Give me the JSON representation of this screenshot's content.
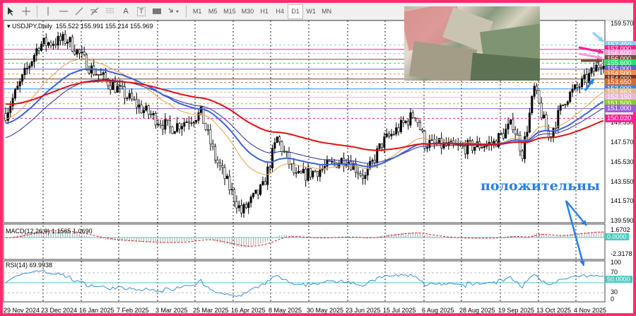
{
  "toolbar": {
    "tools": [
      "cursor",
      "crosshair",
      "vertical-line",
      "horizontal-line",
      "trendline",
      "fibonacci",
      "fibo-channel",
      "text",
      "label",
      "rectangle",
      "arrows"
    ],
    "text_tool": "A",
    "label_tool": "T",
    "timeframes": [
      "M1",
      "M5",
      "M15",
      "M30",
      "H1",
      "H4",
      "D1",
      "W1",
      "MN"
    ],
    "active_timeframe": "D1"
  },
  "header": {
    "symbol": "USDJPY,Daily",
    "ohlc": "155.522 155.991 155.214 155.969"
  },
  "price_axis": [
    "159.570",
    "149.550",
    "147.570",
    "145.530",
    "143.550",
    "141.570",
    "139.590"
  ],
  "levels": [
    {
      "label": "157.450",
      "price": 157.45,
      "color": "#8ccaf2"
    },
    {
      "label": "157.000",
      "price": 157.0,
      "color": "#ff1f8f"
    },
    {
      "label": "156.600",
      "price": 156.6,
      "color": "#f59ad8"
    },
    {
      "label": "156.000",
      "price": 156.0,
      "color": "#7a4b3a"
    },
    {
      "label": "155.600",
      "price": 155.6,
      "color": "#1ee36a"
    },
    {
      "label": "155.000",
      "price": 155.0,
      "color": "#6d5bd0"
    },
    {
      "label": "154.500",
      "price": 154.5,
      "color": "#f58a4c"
    },
    {
      "label": "154.000",
      "price": 154.0,
      "color": "#6b3d22"
    },
    {
      "label": "153.650",
      "price": 153.65,
      "color": "#d8692c"
    },
    {
      "label": "153.000",
      "price": 153.0,
      "color": "#2f8be0"
    },
    {
      "label": "152.663",
      "price": 152.663,
      "color": "#e2b88e"
    },
    {
      "label": "152.150",
      "price": 152.15,
      "color": "#e9b8d4"
    },
    {
      "label": "151.500",
      "price": 151.5,
      "color": "#8acb2a"
    },
    {
      "label": "151.000",
      "price": 151.0,
      "color": "#9b5fd8"
    },
    {
      "label": "150.020",
      "price": 150.02,
      "color": "#ff1f8f"
    }
  ],
  "dates": [
    "29 Nov 2024",
    "23 Dec 2024",
    "16 Jan 2025",
    "7 Feb 2025",
    "3 Mar 2025",
    "25 Mar 2025",
    "16 Apr 2025",
    "8 May 2025",
    "30 May 2025",
    "23 Jun 2025",
    "15 Jul 2025",
    "6 Aug 2025",
    "28 Aug 2025",
    "19 Sep 2025",
    "13 Oct 2025",
    "4 Nov 2025"
  ],
  "macd": {
    "label": "MACD(12,26,9) 1.1565 1.0690",
    "axis": [
      "1.6702",
      "0.0000",
      "-2.3178"
    ]
  },
  "rsi": {
    "label": "RSI(14) 69.9938",
    "axis": [
      "100",
      "70",
      "50.0000",
      "30",
      "0"
    ]
  },
  "annotation": "положительны",
  "colors": {
    "border": "#ff2a6d",
    "bull": "#000000",
    "ma_red": "#e01010",
    "ma_blue": "#3a62d8",
    "ma_orange": "#e0a050",
    "ma_navy": "#2a2a9a",
    "accent": "#2a7fe0"
  },
  "chart_data": {
    "type": "candlestick",
    "symbol": "USDJPY",
    "timeframe": "Daily",
    "ylim": [
      139.59,
      159.57
    ],
    "anchors_bar_price": [
      [
        0,
        150.5
      ],
      [
        14,
        157.5
      ],
      [
        26,
        158
      ],
      [
        36,
        155
      ],
      [
        47,
        153
      ],
      [
        57,
        151
      ],
      [
        69,
        149
      ],
      [
        82,
        150.5
      ],
      [
        88,
        146
      ],
      [
        99,
        140.5
      ],
      [
        108,
        143
      ],
      [
        114,
        148
      ],
      [
        122,
        144
      ],
      [
        134,
        145
      ],
      [
        143,
        146
      ],
      [
        151,
        144
      ],
      [
        158,
        147.5
      ],
      [
        172,
        150.5
      ],
      [
        176,
        147.5
      ],
      [
        191,
        147
      ],
      [
        205,
        147.5
      ],
      [
        213,
        149.5
      ],
      [
        217,
        146.5
      ],
      [
        222,
        153
      ],
      [
        228,
        148
      ],
      [
        235,
        152
      ],
      [
        244,
        154
      ],
      [
        251,
        156
      ]
    ]
  }
}
